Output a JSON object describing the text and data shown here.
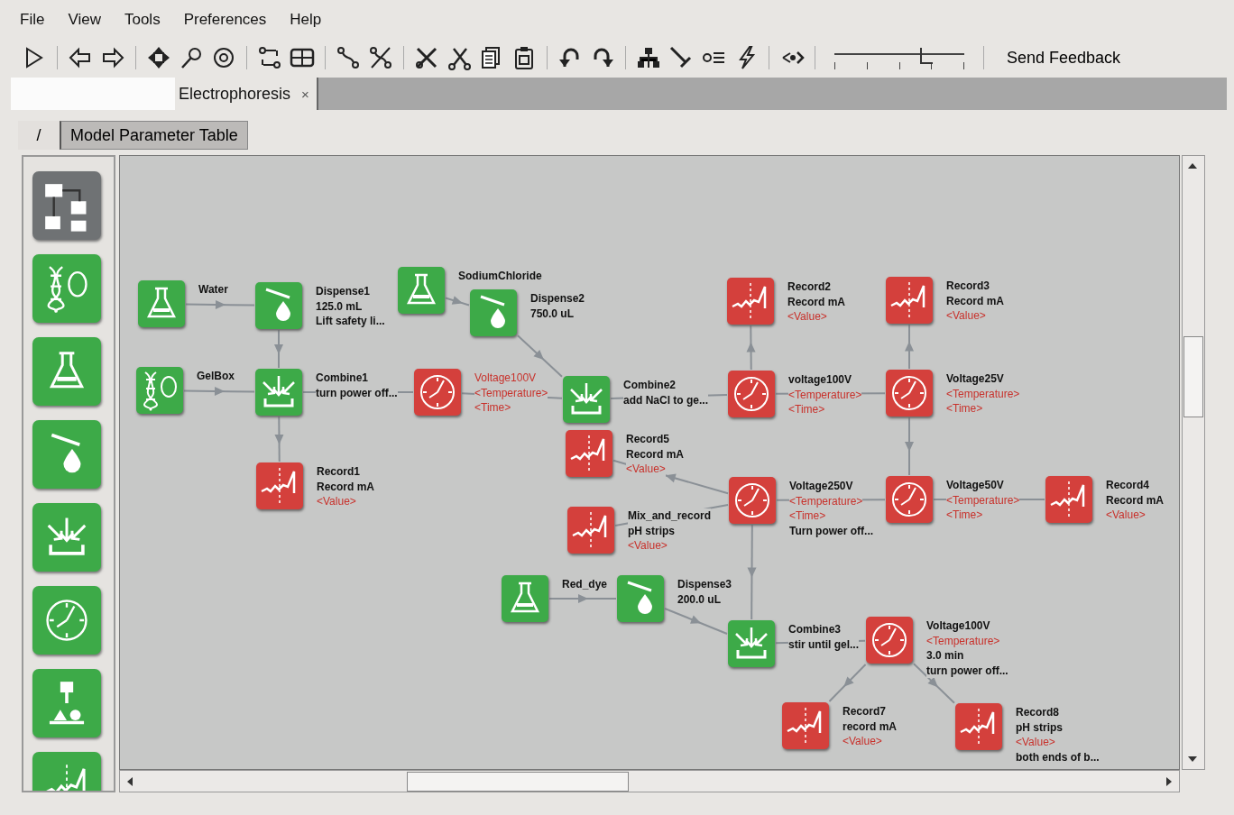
{
  "menu": [
    "File",
    "View",
    "Tools",
    "Preferences",
    "Help"
  ],
  "toolbar": {
    "zoom": {
      "level": 0.7
    },
    "feedback": "Send Feedback"
  },
  "tabs": [
    {
      "label": "Electrophoresis",
      "close": "×",
      "selected": true
    }
  ],
  "view_tabs": [
    {
      "label": "/",
      "selected": false
    },
    {
      "label": "Model Parameter Table",
      "selected": true
    }
  ],
  "nodes": [
    {
      "kind": "flask",
      "lines": [
        {
          "text": "Water",
          "kind": "name"
        }
      ]
    },
    {
      "kind": "dispense",
      "lines": [
        {
          "text": "Dispense1",
          "kind": "name"
        },
        {
          "text": "125.0 mL",
          "kind": "name"
        },
        {
          "text": "Lift safety li...",
          "kind": "name"
        }
      ]
    },
    {
      "kind": "flask",
      "lines": [
        {
          "text": "SodiumChloride",
          "kind": "name"
        }
      ]
    },
    {
      "kind": "dispense",
      "lines": [
        {
          "text": "Dispense2",
          "kind": "name"
        },
        {
          "text": "750.0 uL",
          "kind": "name"
        }
      ]
    },
    {
      "kind": "gel",
      "lines": [
        {
          "text": "GelBox",
          "kind": "name"
        }
      ]
    },
    {
      "kind": "combine",
      "lines": [
        {
          "text": "Combine1",
          "kind": "name"
        },
        {
          "text": "turn power off...",
          "kind": "name"
        }
      ]
    },
    {
      "kind": "timer",
      "lines": [
        {
          "text": "Voltage100V",
          "kind": "param"
        },
        {
          "text": "<Temperature>",
          "kind": "param"
        },
        {
          "text": "<Time>",
          "kind": "param"
        }
      ]
    },
    {
      "kind": "combine",
      "lines": [
        {
          "text": "Combine2",
          "kind": "name"
        },
        {
          "text": "add NaCl to ge...",
          "kind": "name"
        }
      ]
    },
    {
      "kind": "record",
      "lines": [
        {
          "text": "Record1",
          "kind": "name"
        },
        {
          "text": "Record mA",
          "kind": "name"
        },
        {
          "text": "<Value>",
          "kind": "param"
        }
      ]
    },
    {
      "kind": "record",
      "lines": [
        {
          "text": "Record2",
          "kind": "name"
        },
        {
          "text": "Record mA",
          "kind": "name"
        },
        {
          "text": "<Value>",
          "kind": "param"
        }
      ]
    },
    {
      "kind": "record",
      "lines": [
        {
          "text": "Record3",
          "kind": "name"
        },
        {
          "text": "Record mA",
          "kind": "name"
        },
        {
          "text": "<Value>",
          "kind": "param"
        }
      ]
    },
    {
      "kind": "timer",
      "lines": [
        {
          "text": "voltage100V",
          "kind": "name"
        },
        {
          "text": "<Temperature>",
          "kind": "param"
        },
        {
          "text": "<Time>",
          "kind": "param"
        }
      ]
    },
    {
      "kind": "timer",
      "lines": [
        {
          "text": "Voltage25V",
          "kind": "name"
        },
        {
          "text": "<Temperature>",
          "kind": "param"
        },
        {
          "text": "<Time>",
          "kind": "param"
        }
      ]
    },
    {
      "kind": "record",
      "lines": [
        {
          "text": "Record5",
          "kind": "name"
        },
        {
          "text": "Record mA",
          "kind": "name"
        },
        {
          "text": "<Value>",
          "kind": "param"
        }
      ]
    },
    {
      "kind": "timer",
      "lines": [
        {
          "text": "Voltage250V",
          "kind": "name"
        },
        {
          "text": "<Temperature>",
          "kind": "param"
        },
        {
          "text": "<Time>",
          "kind": "param"
        },
        {
          "text": "Turn power off...",
          "kind": "name"
        }
      ]
    },
    {
      "kind": "timer",
      "lines": [
        {
          "text": "Voltage50V",
          "kind": "name"
        },
        {
          "text": "<Temperature>",
          "kind": "param"
        },
        {
          "text": "<Time>",
          "kind": "param"
        }
      ]
    },
    {
      "kind": "record",
      "lines": [
        {
          "text": "Record4",
          "kind": "name"
        },
        {
          "text": "Record mA",
          "kind": "name"
        },
        {
          "text": "<Value>",
          "kind": "param"
        }
      ]
    },
    {
      "kind": "record",
      "lines": [
        {
          "text": "Mix_and_record",
          "kind": "name"
        },
        {
          "text": "pH strips",
          "kind": "name"
        },
        {
          "text": "<Value>",
          "kind": "param"
        }
      ]
    },
    {
      "kind": "flask",
      "lines": [
        {
          "text": "Red_dye",
          "kind": "name"
        }
      ]
    },
    {
      "kind": "dispense",
      "lines": [
        {
          "text": "Dispense3",
          "kind": "name"
        },
        {
          "text": "200.0 uL",
          "kind": "name"
        }
      ]
    },
    {
      "kind": "combine",
      "lines": [
        {
          "text": "Combine3",
          "kind": "name"
        },
        {
          "text": "stir until gel...",
          "kind": "name"
        }
      ]
    },
    {
      "kind": "timer",
      "lines": [
        {
          "text": "Voltage100V",
          "kind": "name"
        },
        {
          "text": "<Temperature>",
          "kind": "param"
        },
        {
          "text": "3.0 min",
          "kind": "name"
        },
        {
          "text": "turn power off...",
          "kind": "name"
        }
      ]
    },
    {
      "kind": "record",
      "lines": [
        {
          "text": "Record7",
          "kind": "name"
        },
        {
          "text": "record mA",
          "kind": "name"
        },
        {
          "text": "<Value>",
          "kind": "param"
        }
      ]
    },
    {
      "kind": "record",
      "lines": [
        {
          "text": "Record8",
          "kind": "name"
        },
        {
          "text": "pH strips",
          "kind": "name"
        },
        {
          "text": "<Value>",
          "kind": "param"
        },
        {
          "text": "both ends of b...",
          "kind": "name"
        }
      ]
    }
  ]
}
